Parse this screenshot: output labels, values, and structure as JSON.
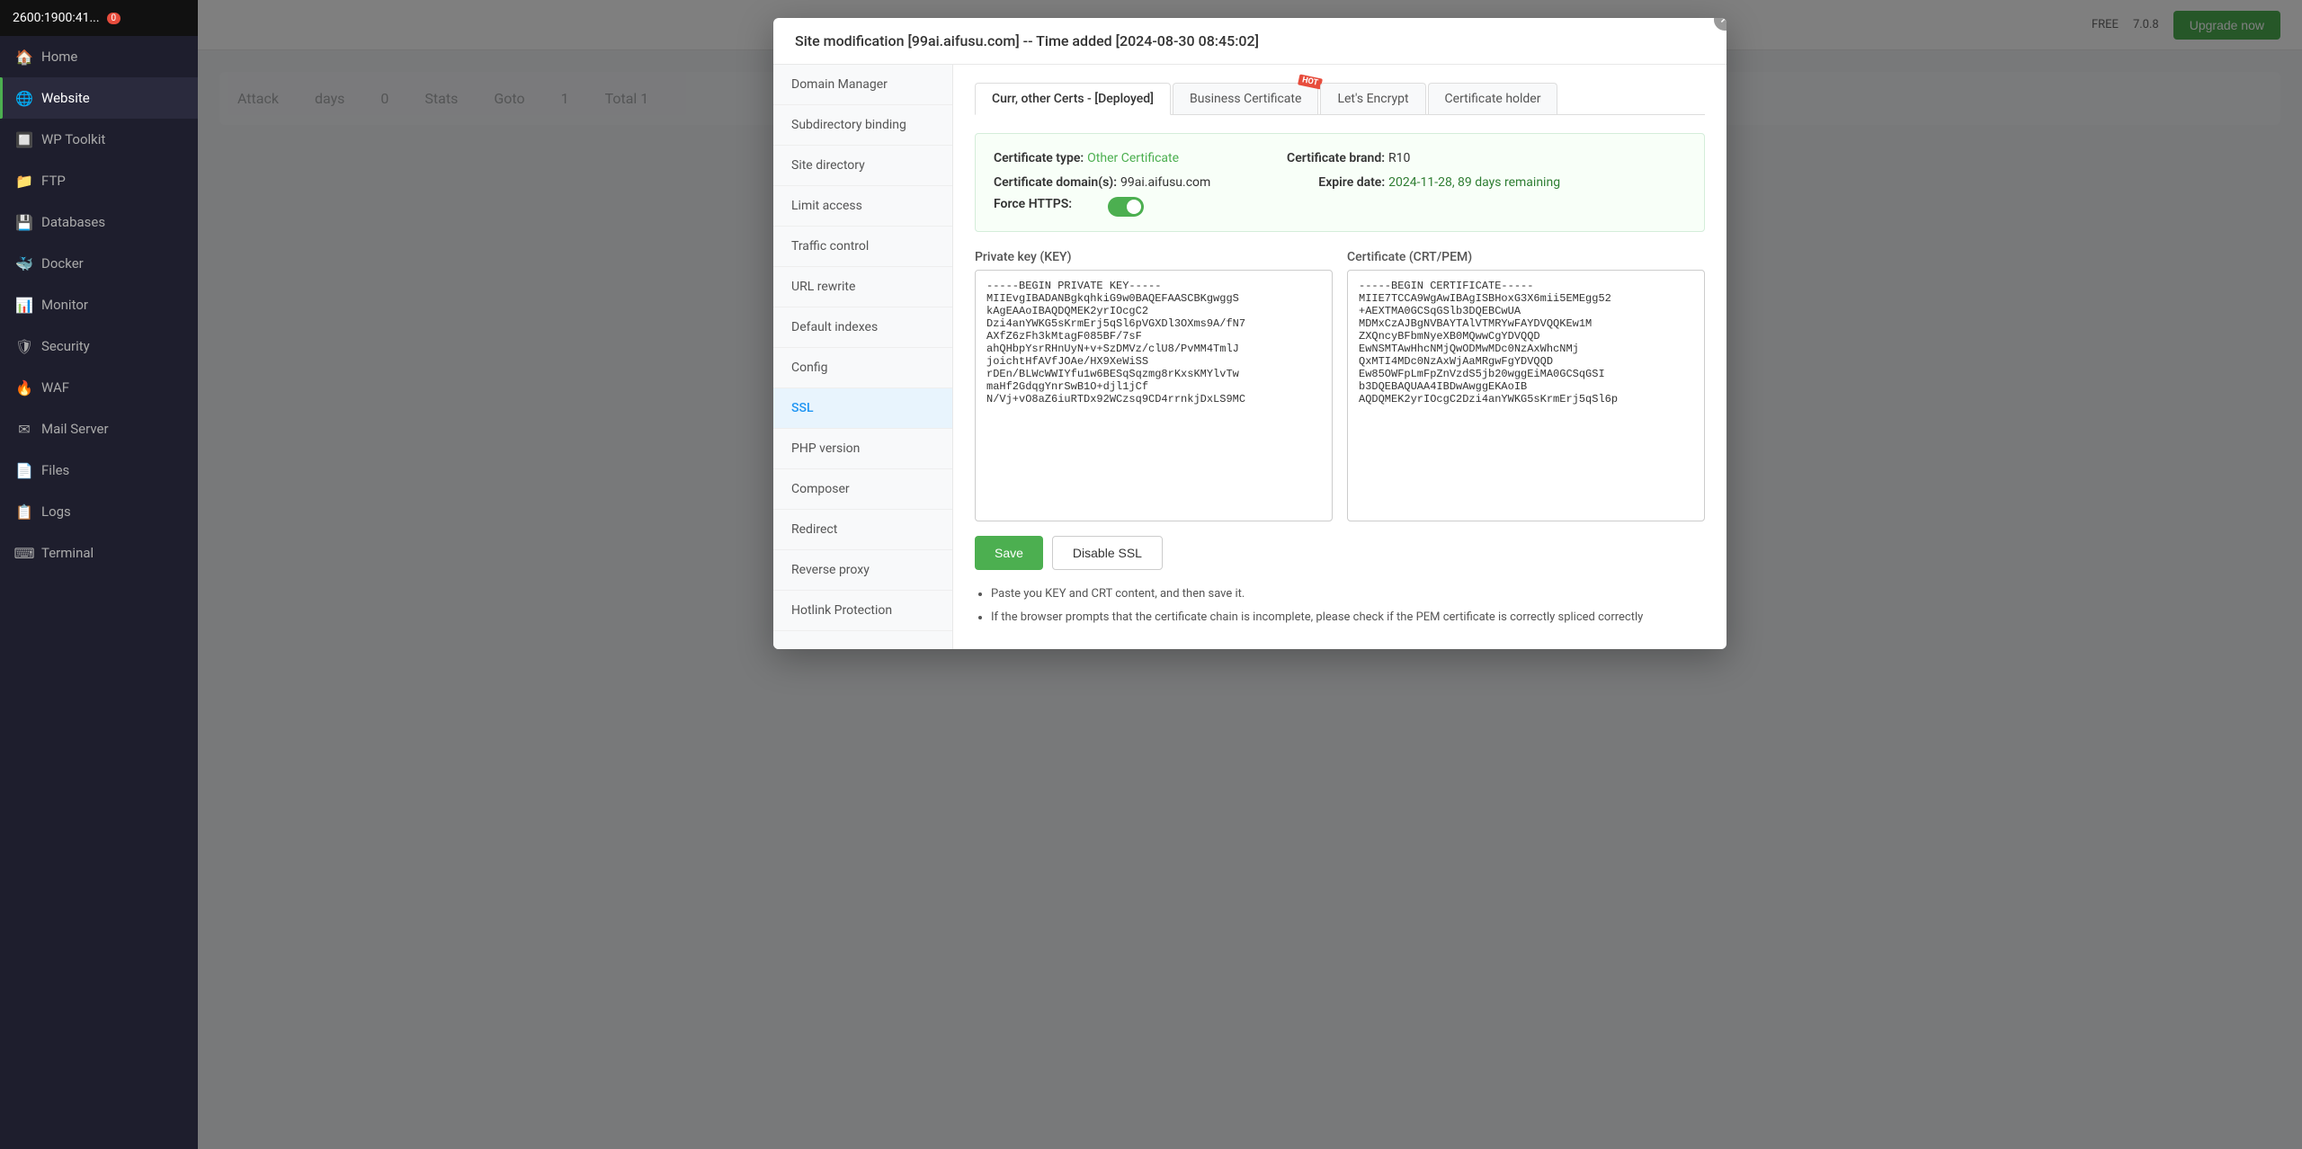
{
  "sidebar": {
    "header": {
      "ip": "2600:1900:41...",
      "badge": "0"
    },
    "items": [
      {
        "id": "home",
        "label": "Home",
        "icon": "🏠",
        "active": false
      },
      {
        "id": "website",
        "label": "Website",
        "icon": "🌐",
        "active": true
      },
      {
        "id": "wp-toolkit",
        "label": "WP Toolkit",
        "icon": "🔲",
        "active": false
      },
      {
        "id": "ftp",
        "label": "FTP",
        "icon": "📁",
        "active": false
      },
      {
        "id": "databases",
        "label": "Databases",
        "icon": "💾",
        "active": false
      },
      {
        "id": "docker",
        "label": "Docker",
        "icon": "🐳",
        "active": false
      },
      {
        "id": "monitor",
        "label": "Monitor",
        "icon": "📊",
        "active": false
      },
      {
        "id": "security",
        "label": "Security",
        "icon": "🛡",
        "active": false
      },
      {
        "id": "waf",
        "label": "WAF",
        "icon": "🔥",
        "active": false
      },
      {
        "id": "mail-server",
        "label": "Mail Server",
        "icon": "✉",
        "active": false
      },
      {
        "id": "files",
        "label": "Files",
        "icon": "📄",
        "active": false
      },
      {
        "id": "logs",
        "label": "Logs",
        "icon": "📋",
        "active": false
      },
      {
        "id": "terminal",
        "label": "Terminal",
        "icon": "⌨",
        "active": false
      }
    ]
  },
  "topbar": {
    "free_label": "FREE",
    "version": "7.0.8",
    "upgrade_label": "Upgrade now"
  },
  "modal": {
    "title": "Site modification [99ai.aifusu.com] -- Time added [2024-08-30 08:45:02]",
    "nav_items": [
      {
        "id": "domain-manager",
        "label": "Domain Manager",
        "active": false
      },
      {
        "id": "subdirectory-binding",
        "label": "Subdirectory binding",
        "active": false
      },
      {
        "id": "site-directory",
        "label": "Site directory",
        "active": false
      },
      {
        "id": "limit-access",
        "label": "Limit access",
        "active": false
      },
      {
        "id": "traffic-control",
        "label": "Traffic control",
        "active": false
      },
      {
        "id": "url-rewrite",
        "label": "URL rewrite",
        "active": false
      },
      {
        "id": "default-indexes",
        "label": "Default indexes",
        "active": false
      },
      {
        "id": "config",
        "label": "Config",
        "active": false
      },
      {
        "id": "ssl",
        "label": "SSL",
        "active": true
      },
      {
        "id": "php-version",
        "label": "PHP version",
        "active": false
      },
      {
        "id": "composer",
        "label": "Composer",
        "active": false
      },
      {
        "id": "redirect",
        "label": "Redirect",
        "active": false
      },
      {
        "id": "reverse-proxy",
        "label": "Reverse proxy",
        "active": false
      },
      {
        "id": "hotlink-protection",
        "label": "Hotlink Protection",
        "active": false
      }
    ],
    "tabs": [
      {
        "id": "curr-certs",
        "label": "Curr, other Certs - [Deployed]",
        "active": true,
        "hot": false
      },
      {
        "id": "business-cert",
        "label": "Business Certificate",
        "active": false,
        "hot": true
      },
      {
        "id": "lets-encrypt",
        "label": "Let's Encrypt",
        "active": false,
        "hot": false
      },
      {
        "id": "cert-holder",
        "label": "Certificate holder",
        "active": false,
        "hot": false
      }
    ],
    "cert_info": {
      "type_label": "Certificate type:",
      "type_value": "Other Certificate",
      "brand_label": "Certificate brand:",
      "brand_value": "R10",
      "domain_label": "Certificate domain(s):",
      "domain_value": "99ai.aifusu.com",
      "expire_label": "Expire date:",
      "expire_value": "2024-11-28, 89 days remaining",
      "force_https_label": "Force HTTPS:"
    },
    "private_key_label": "Private key (KEY)",
    "cert_label": "Certificate (CRT/PEM)",
    "private_key_value": "-----BEGIN PRIVATE KEY-----\nMIIEvgIBADANBgkqhkiG9w0BAQEFAASCBKgwggS\nkAgEAAoIBAQDQMEK2yrIOcgC2\nDzi4anYWKG5sKrmErj5qSl6pVGXDl3OXms9A/fN7\nAXfZ6zFh3kMtagF085BF/7sF\nahQHbpYsrRHnUyN+v+SzDMVz/clU8/PvMM4TmlJ\njoichtHfAVfJOAe/HX9XeWiSS\nrDEn/BLWcWWIYfu1w6BESqSqzmg8rKxsKMYlvTw\nmaHf2GdqgYnrSwB1O+djl1jCf\nN/Vj+vO8aZ6iuRTDx92WCzsq9CD4rrnkjDxLS9MC",
    "cert_value": "-----BEGIN CERTIFICATE-----\nMIIE7TCCA9WgAwIBAgISBHoxG3X6mii5EMEgg52\n+AEXTMA0GCSqGSlb3DQEBCwUA\nMDMxCzAJBgNVBAYTAlVTMRYwFAYDVQQKEw1M\nZXQncyBFbmNyeXB0MQwwCgYDVQQD\nEwNSMTAwHhcNMjQwODMwMDc0NzAxWhcNMj\nQxMTI4MDc0NzAxWjAaMRgwFgYDVQQD\nEw85OWFpLmFpZnVzdS5jb20wggEiMA0GCSqGSI\nb3DQEBAQUAA4IBDwAwggEKAoIB\nAQDQMEK2yrIOcgC2Dzi4anYWKG5sKrmErj5qSl6p",
    "save_label": "Save",
    "disable_ssl_label": "Disable SSL",
    "notes": [
      "Paste you KEY and CRT content, and then save it.",
      "If the browser prompts that the certificate chain is incomplete, please check if the PEM certificate is correctly spliced correctly"
    ]
  },
  "background": {
    "attack_label": "Attack",
    "days_label": "days",
    "zero": "0",
    "stats_label": "Stats",
    "goto_label": "Goto",
    "page_num": "1",
    "total_label": "Total 1"
  }
}
